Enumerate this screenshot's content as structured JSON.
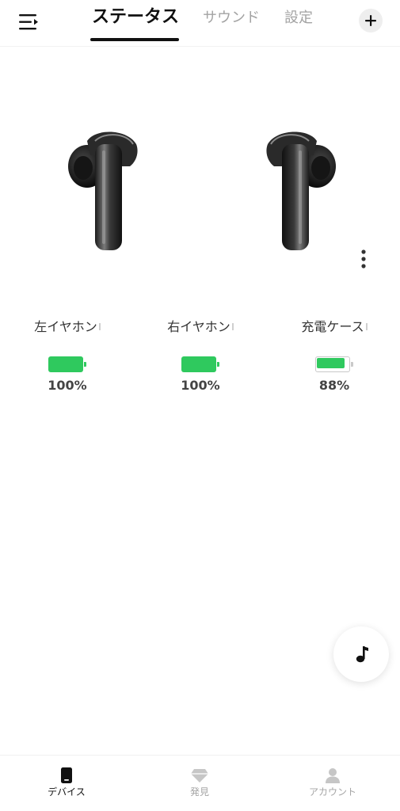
{
  "header": {
    "menu_icon": "menu-icon",
    "tabs": [
      {
        "label": "ステータス",
        "active": true
      },
      {
        "label": "サウンド",
        "active": false
      },
      {
        "label": "設定",
        "active": false
      }
    ],
    "add_icon": "plus-icon"
  },
  "devices": [
    {
      "name": "左イヤホン",
      "battery": "100%",
      "level": 100,
      "charging": false
    },
    {
      "name": "右イヤホン",
      "battery": "100%",
      "level": 100,
      "charging": false
    },
    {
      "name": "充電ケース",
      "battery": "88%",
      "level": 88,
      "charging": false
    }
  ],
  "more_icon": "more-vertical-icon",
  "music_button_icon": "music-note-icon",
  "bottom_nav": [
    {
      "label": "デバイス",
      "icon": "device-icon",
      "active": true
    },
    {
      "label": "発見",
      "icon": "diamond-icon",
      "active": false
    },
    {
      "label": "アカウント",
      "icon": "account-icon",
      "active": false
    }
  ],
  "colors": {
    "accent": "#111111",
    "battery_green": "#2fc95e",
    "inactive_text": "#a3a3a3"
  }
}
